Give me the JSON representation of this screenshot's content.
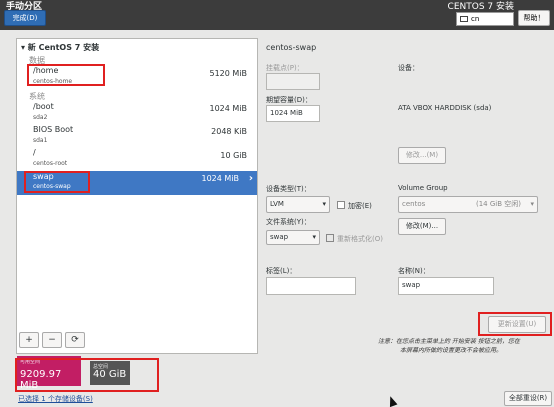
{
  "header": {
    "title": "手动分区",
    "done_label": "完成(D)",
    "product": "CENTOS 7 安装",
    "keyboard": "cn",
    "help_label": "帮助！"
  },
  "left": {
    "group_title": "▾ 新 CentOS 7 安装",
    "sections": {
      "data": "数据",
      "system": "系统"
    },
    "partitions": [
      {
        "name": "/home",
        "device": "centos-home",
        "size": "5120 MiB"
      },
      {
        "name": "/boot",
        "device": "sda2",
        "size": "1024 MiB"
      },
      {
        "name": "BIOS Boot",
        "device": "sda1",
        "size": "2048 KiB"
      },
      {
        "name": "/",
        "device": "centos-root",
        "size": "10 GiB"
      },
      {
        "name": "swap",
        "device": "centos-swap",
        "size": "1024 MiB"
      }
    ],
    "toolbar": {
      "add": "+",
      "remove": "−",
      "refresh": "⟳"
    }
  },
  "space": {
    "available_label": "可用空间",
    "available_value": "9209.97 MiB",
    "total_label": "总空间",
    "total_value": "40 GiB"
  },
  "selected_devices_link": "已选择 1 个存储设备(S)",
  "details": {
    "title": "centos-swap",
    "mount_point_label": "挂载点(P)：",
    "mount_point_value": "",
    "capacity_label": "期望容量(D)：",
    "capacity_value": "1024 MiB",
    "device_label": "设备：",
    "device_value": "ATA VBOX HARDDISK (sda)",
    "modify_device_label": "修改...(M)",
    "device_type_label": "设备类型(T)：",
    "device_type_value": "LVM",
    "encrypt_label": "加密(E)",
    "fs_label": "文件系统(Y)：",
    "fs_value": "swap",
    "reformat_label": "重新格式化(O)",
    "vg_label": "Volume Group",
    "vg_value": "centos",
    "vg_free": "(14 GiB 空闲)",
    "vg_modify_label": "修改(M)...",
    "tag_label": "标签(L)：",
    "tag_value": "",
    "name_label": "名称(N)：",
    "name_value": "swap",
    "update_label": "更新设置(U)",
    "note_line1": "注意：在您点击主菜单上的 开始安装 按钮之前，您在",
    "note_line2": "本屏幕内所做的设置更改不会被应用。",
    "reset_label": "全部重设(R)"
  }
}
